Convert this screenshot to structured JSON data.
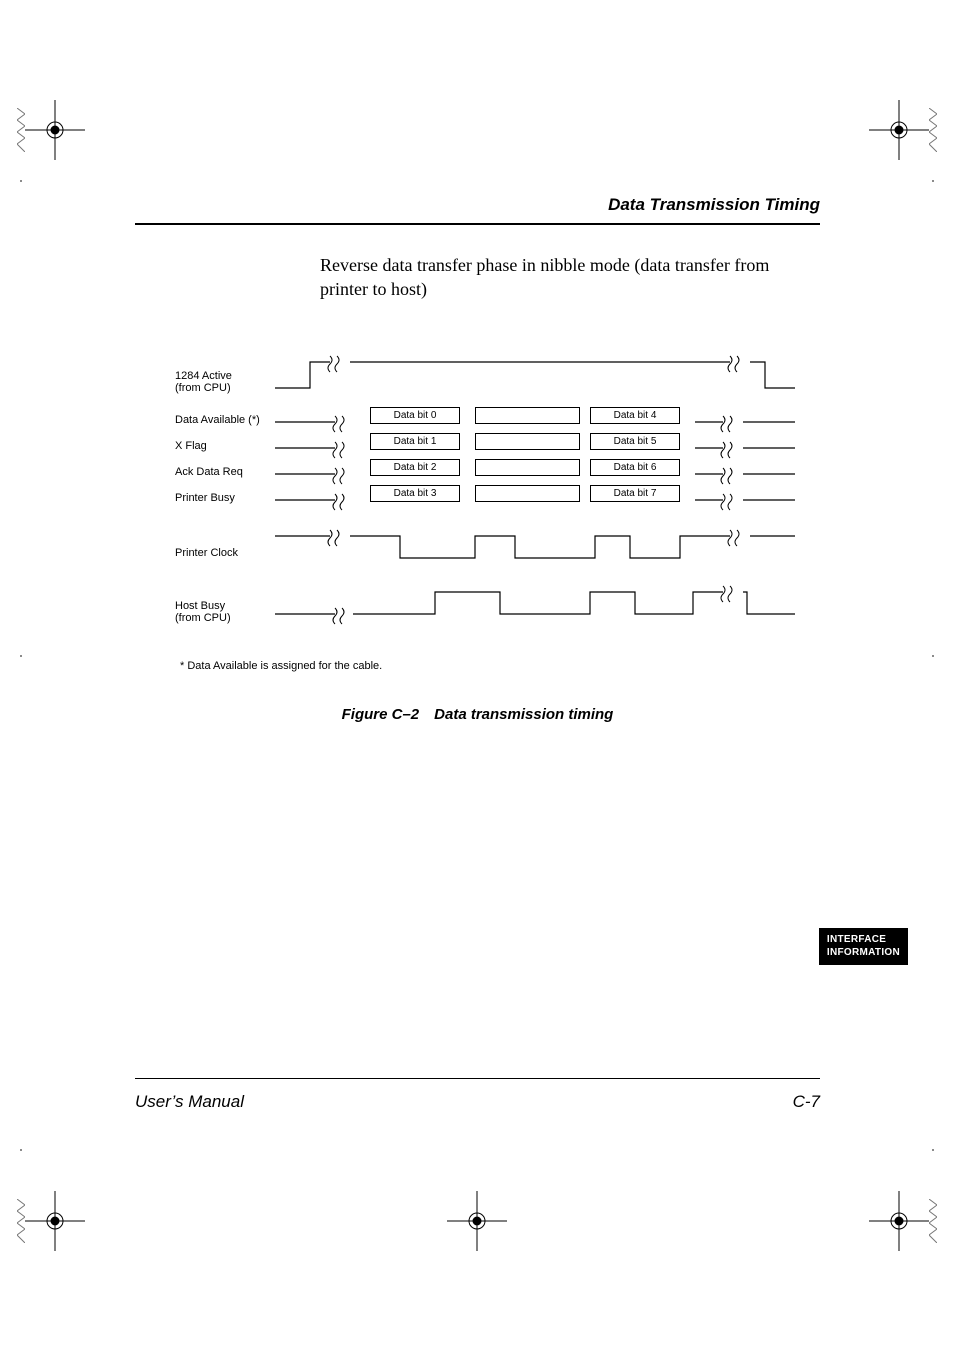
{
  "header": {
    "running_title": "Data Transmission Timing"
  },
  "paragraph": "Reverse data transfer phase in nibble mode (data transfer from printer to host)",
  "signals": {
    "s1_l1": "1284 Active",
    "s1_l2": "(from CPU)",
    "s2": "Data Available (*)",
    "s3": "X Flag",
    "s4": "Ack Data Req",
    "s5": "Printer Busy",
    "s6": "Printer Clock",
    "s7_l1": "Host Busy",
    "s7_l2": "(from CPU)"
  },
  "bits": {
    "b0": "Data bit 0",
    "b1": "Data bit 1",
    "b2": "Data bit 2",
    "b3": "Data bit 3",
    "b4": "Data bit 4",
    "b5": "Data bit 5",
    "b6": "Data bit 6",
    "b7": "Data bit 7"
  },
  "footnote": "* Data Available is assigned for the cable.",
  "figure_caption": "Figure C–2 Data transmission timing",
  "sidebar": {
    "l1": "INTERFACE",
    "l2": "INFORMATION"
  },
  "footer": {
    "left": "User’s Manual",
    "right": "C-7"
  }
}
